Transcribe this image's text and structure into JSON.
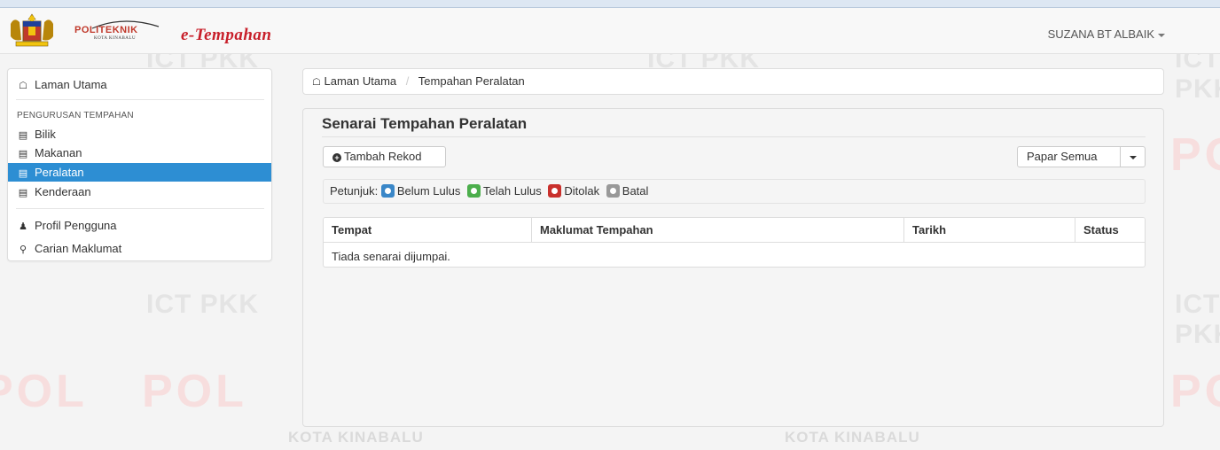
{
  "header": {
    "brand_poli": "POLITEKNIK",
    "brand_poli_sub": "KOTA KINABALU",
    "brand_app": "e-Tempahan",
    "user_name": "SUZANA BT ALBAIK"
  },
  "watermark": {
    "ict": "ICT PKK",
    "kota": "KOTA KINABALU",
    "poli": "POL"
  },
  "sidebar": {
    "home": "Laman Utama",
    "section_header": "PENGURUSAN TEMPAHAN",
    "items": [
      {
        "label": "Bilik",
        "icon": "list-icon"
      },
      {
        "label": "Makanan",
        "icon": "list-icon"
      },
      {
        "label": "Peralatan",
        "icon": "list-icon",
        "active": true
      },
      {
        "label": "Kenderaan",
        "icon": "list-icon"
      }
    ],
    "profile": "Profil Pengguna",
    "search": "Carian Maklumat"
  },
  "breadcrumb": {
    "home": "Laman Utama",
    "current": "Tempahan Peralatan"
  },
  "main": {
    "title": "Senarai Tempahan Peralatan",
    "add_button": "Tambah Rekod",
    "filter_button": "Papar Semua",
    "legend": {
      "prefix": "Petunjuk:",
      "items": [
        {
          "label": "Belum Lulus",
          "color": "#3a87c8"
        },
        {
          "label": "Telah Lulus",
          "color": "#4cae4c"
        },
        {
          "label": "Ditolak",
          "color": "#c9302c"
        },
        {
          "label": "Batal",
          "color": "#999999"
        }
      ]
    },
    "table": {
      "headers": [
        "Tempat",
        "Maklumat Tempahan",
        "Tarikh",
        "Status"
      ],
      "empty_message": "Tiada senarai dijumpai."
    }
  }
}
